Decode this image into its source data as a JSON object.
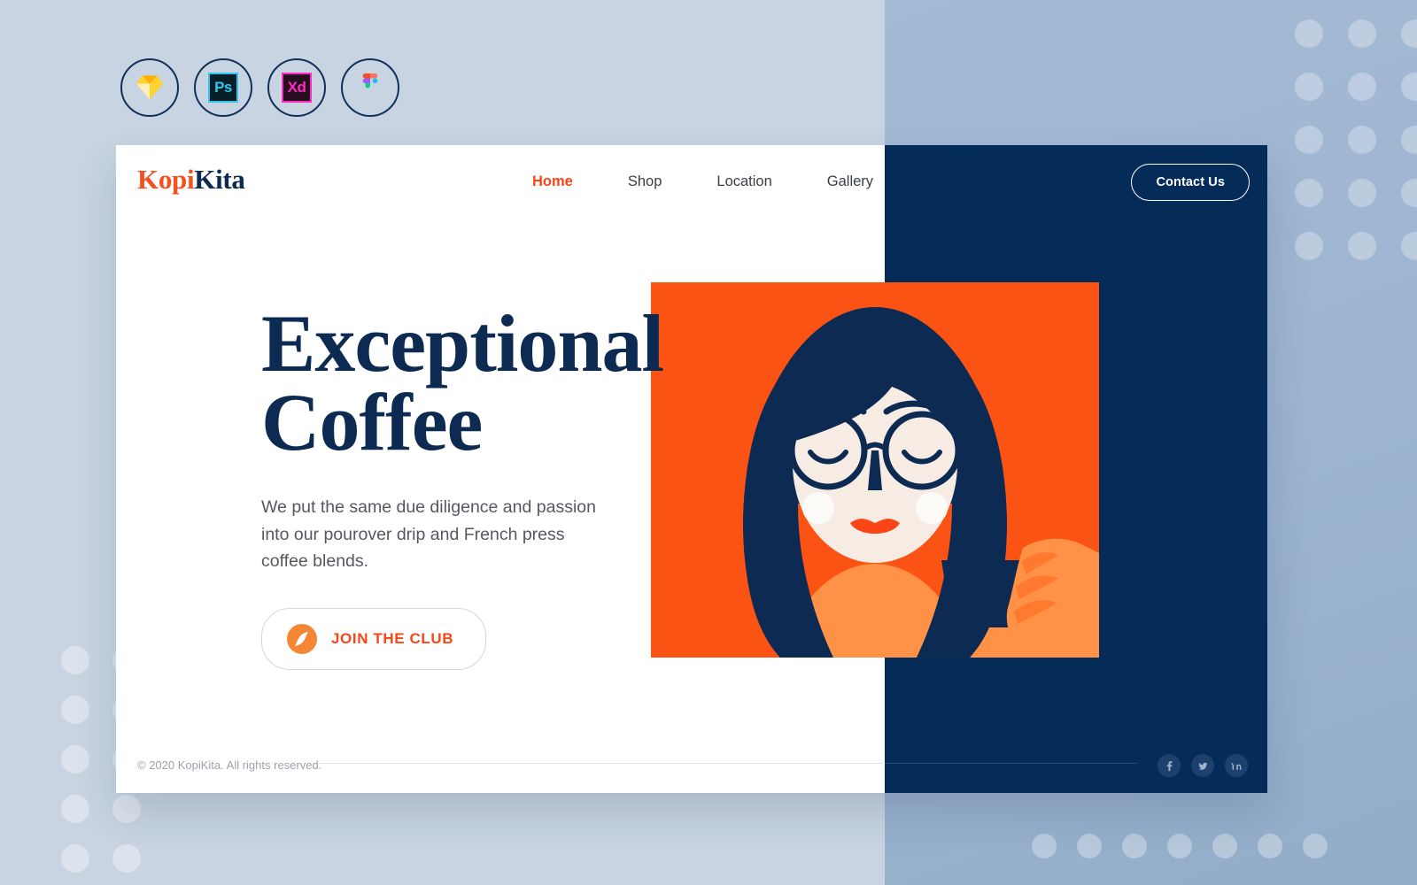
{
  "meta": {
    "theme": {
      "navy": "#052b59",
      "deep_navy": "#0c2a52",
      "orange": "#fa4616",
      "orange_panel": "#fb5313",
      "cream": "#f7ece4",
      "bg_left": "#c8d4e1",
      "bg_right": "#9fb6d2",
      "card_white": "#ffffff"
    }
  },
  "app_badges": [
    {
      "name": "Sketch",
      "icon": "sketch-icon"
    },
    {
      "name": "Photoshop",
      "label": "Ps",
      "icon": "photoshop-icon"
    },
    {
      "name": "Adobe XD",
      "label": "Xd",
      "icon": "adobe-xd-icon"
    },
    {
      "name": "Figma",
      "icon": "figma-icon"
    }
  ],
  "header": {
    "logo": {
      "part1": "Kopi",
      "part2": "Kita"
    },
    "nav": [
      {
        "label": "Home",
        "active": true
      },
      {
        "label": "Shop",
        "active": false
      },
      {
        "label": "Location",
        "active": false
      },
      {
        "label": "Gallery",
        "active": false
      }
    ],
    "contact_button": "Contact Us"
  },
  "hero": {
    "headline_line1": "Exceptional",
    "headline_line2": "Coffee",
    "body": "We put the same due diligence and passion into our pourover drip and French press coffee blends.",
    "cta_label": "JOIN THE CLUB",
    "cta_icon": "coffee-bean-icon"
  },
  "illustration": {
    "alt": "Woman with round glasses holding a coffee cup",
    "background_color": "#fb5313",
    "hair_color": "#0c2a52",
    "skin_color": "#f7ece4",
    "lips_color": "#fa4616",
    "cup_color": "#0c2a52",
    "shoulder_color": "#ff9247"
  },
  "footer": {
    "copyright": "© 2020 KopiKita. All rights reserved.",
    "socials": [
      {
        "name": "Facebook",
        "icon": "facebook-icon"
      },
      {
        "name": "Twitter",
        "icon": "twitter-icon"
      },
      {
        "name": "LinkedIn",
        "icon": "linkedin-icon"
      }
    ]
  },
  "decor": {
    "dots_topright": {
      "cols": 3,
      "rows": 5
    },
    "dots_left": {
      "cols": 2,
      "rows": 5
    },
    "dots_bottom": {
      "cols": 7,
      "rows": 1
    }
  }
}
